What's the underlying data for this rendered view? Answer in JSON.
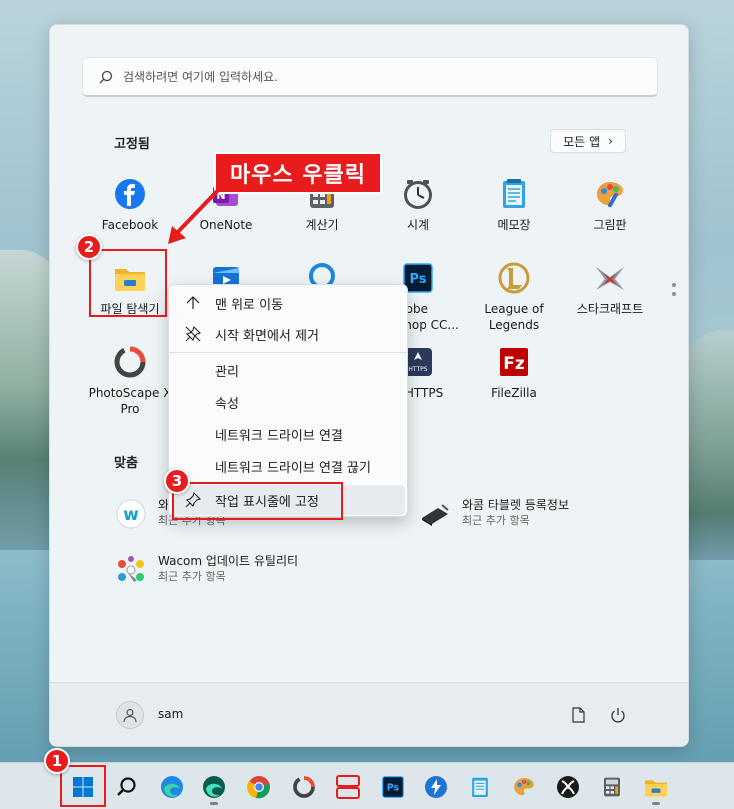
{
  "search": {
    "placeholder": "검색하려면 여기에 입력하세요."
  },
  "pinned": {
    "title": "고정됨",
    "all_apps_label": "모든 앱",
    "apps": [
      {
        "name": "facebook",
        "label": "Facebook",
        "icon": "facebook-icon"
      },
      {
        "name": "onenote",
        "label": "OneNote",
        "icon": "onenote-icon"
      },
      {
        "name": "calculator",
        "label": "계산기",
        "icon": "calculator-icon"
      },
      {
        "name": "clock",
        "label": "시계",
        "icon": "clock-icon"
      },
      {
        "name": "notepad",
        "label": "메모장",
        "icon": "notepad-icon"
      },
      {
        "name": "paint",
        "label": "그림판",
        "icon": "paint-icon"
      },
      {
        "name": "file-explorer",
        "label": "파일 탐색기",
        "icon": "folder-icon"
      },
      {
        "name": "video",
        "label": "",
        "icon": "video-icon"
      },
      {
        "name": "cortana",
        "label": "",
        "icon": "cortana-icon"
      },
      {
        "name": "photoshop",
        "label": "dobe\nshop CC...",
        "icon": "photoshop-icon"
      },
      {
        "name": "league-of-legends",
        "label": "League of\nLegends",
        "icon": "lol-icon"
      },
      {
        "name": "starcraft",
        "label": "스타크래프트",
        "icon": "starcraft-icon"
      },
      {
        "name": "photoscape",
        "label": "PhotoScape X\nPro",
        "icon": "photoscape-icon"
      },
      {
        "name": "https",
        "label": "른 HTTPS",
        "icon": "https-icon"
      },
      {
        "name": "filezilla",
        "label": "FileZilla",
        "icon": "filezilla-icon"
      }
    ]
  },
  "recommended": {
    "title": "맞춤",
    "items": [
      {
        "name": "와",
        "sub": "최근 추가 항목",
        "icon": "wacom-w-icon"
      },
      {
        "name": "와콤 타블렛 등록정보",
        "sub": "최근 추가 항목",
        "icon": "tablet-icon"
      },
      {
        "name": "Wacom 업데이트 유틸리티",
        "sub": "최근 추가 항목",
        "icon": "wacom-update-icon"
      }
    ]
  },
  "context_menu": {
    "items": [
      {
        "label": "맨 위로 이동",
        "icon": "arrow-up-icon"
      },
      {
        "label": "시작 화면에서 제거",
        "icon": "unpin-icon"
      },
      {
        "label": "관리",
        "icon": ""
      },
      {
        "label": "속성",
        "icon": ""
      },
      {
        "label": "네트워크 드라이브 연결",
        "icon": ""
      },
      {
        "label": "네트워크 드라이브 연결 끊기",
        "icon": ""
      },
      {
        "label": "작업 표시줄에 고정",
        "icon": "pin-icon"
      }
    ]
  },
  "user": {
    "name": "sam"
  },
  "annotations": {
    "callout": "마우스 우클릭",
    "badge1": "1",
    "badge2": "2",
    "badge3": "3",
    "accent": "#e81c1c"
  },
  "taskbar": {
    "items": [
      "start-icon",
      "search-icon",
      "edge-icon",
      "edge-dev-icon",
      "chrome-icon",
      "photoscape-icon",
      "layout-icon",
      "photoshop-icon",
      "https-icon",
      "notepad-icon",
      "paint-icon",
      "xbox-icon",
      "calculator-icon",
      "folder-icon"
    ]
  }
}
